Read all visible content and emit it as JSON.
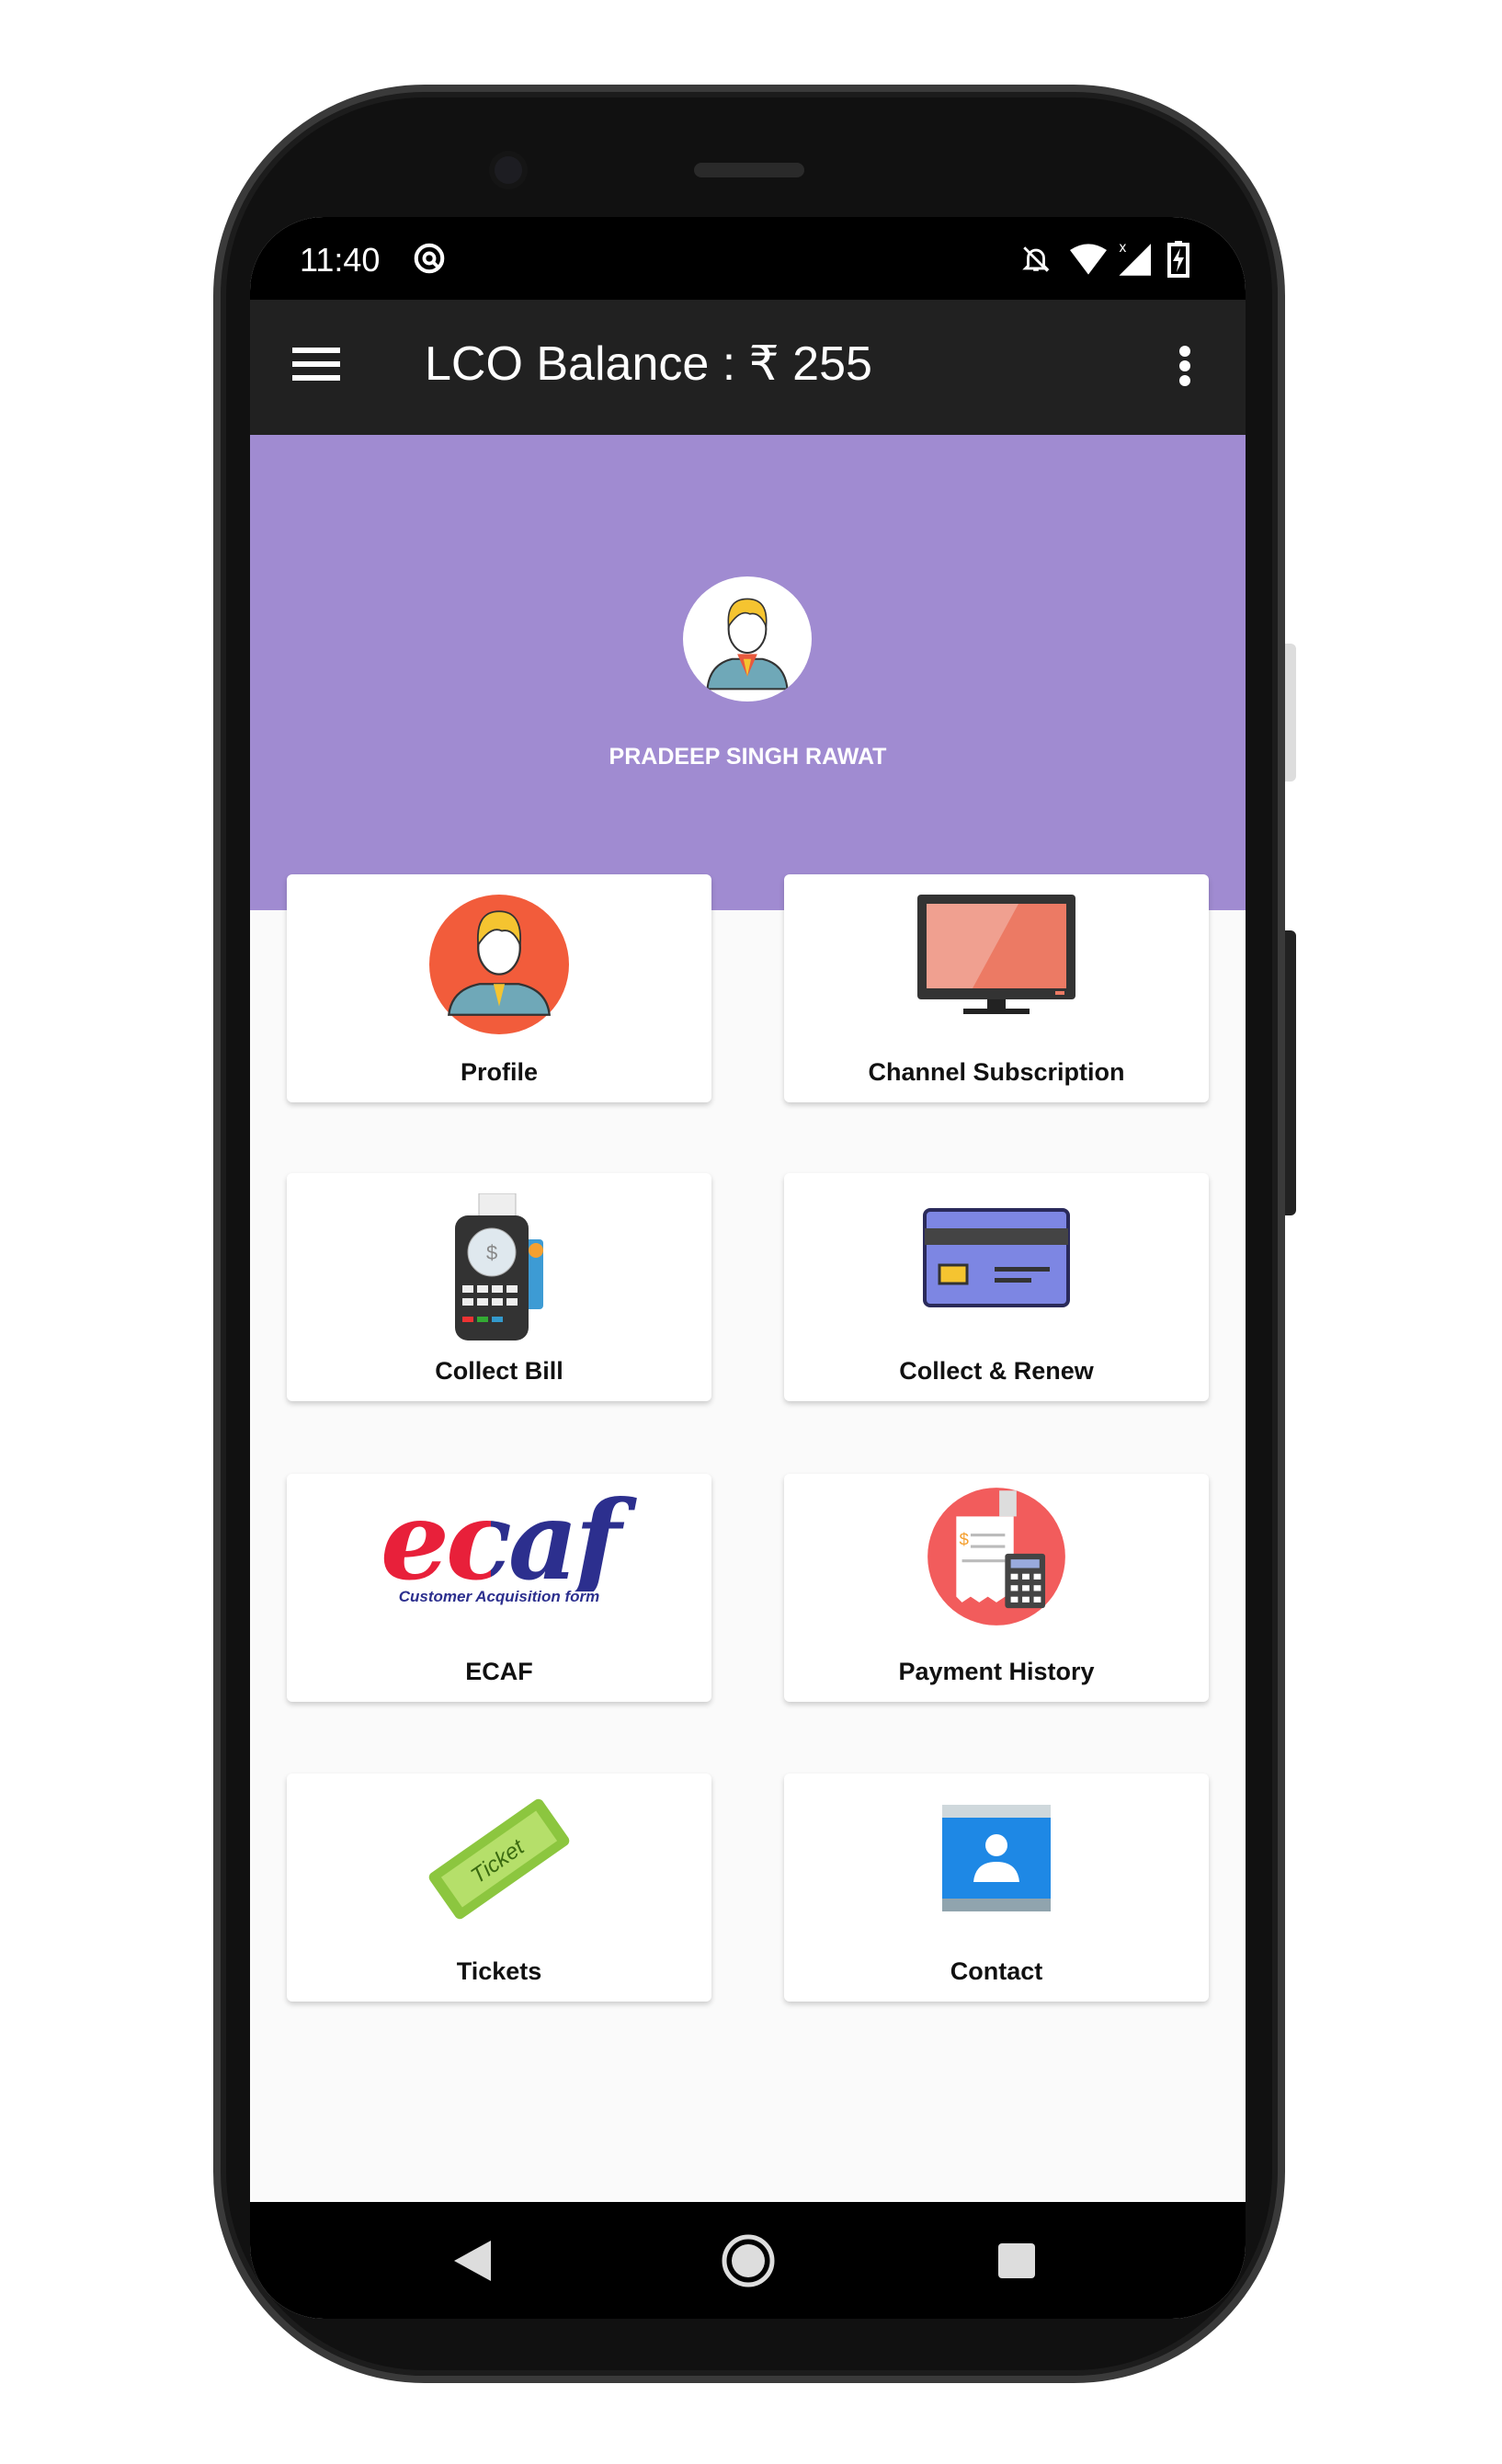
{
  "status_bar": {
    "time": "11:40",
    "icons": [
      "at-sign-icon",
      "bell-off-icon",
      "wifi-icon",
      "signal-icon",
      "battery-charging-icon"
    ]
  },
  "app_bar": {
    "title": "LCO Balance : ₹ 255",
    "menu_icon": "hamburger-icon",
    "overflow_icon": "more-vert-icon"
  },
  "header": {
    "user_name": "PRADEEP SINGH RAWAT",
    "background": "#a08bd1"
  },
  "tiles": [
    {
      "label": "Profile",
      "icon": "profile-icon"
    },
    {
      "label": "Channel Subscription",
      "icon": "tv-icon"
    },
    {
      "label": "Collect Bill",
      "icon": "card-terminal-icon"
    },
    {
      "label": "Collect & Renew",
      "icon": "credit-card-icon"
    },
    {
      "label": "ECAF",
      "icon": "ecaf-logo",
      "logo_text": "ecaf",
      "logo_subtext": "Customer Acquisition form"
    },
    {
      "label": "Payment History",
      "icon": "receipt-calculator-icon"
    },
    {
      "label": "Tickets",
      "icon": "ticket-icon",
      "icon_text": "Ticket"
    },
    {
      "label": "Contact",
      "icon": "contact-card-icon"
    }
  ],
  "nav_bar": {
    "buttons": [
      "back",
      "home",
      "recents"
    ]
  }
}
